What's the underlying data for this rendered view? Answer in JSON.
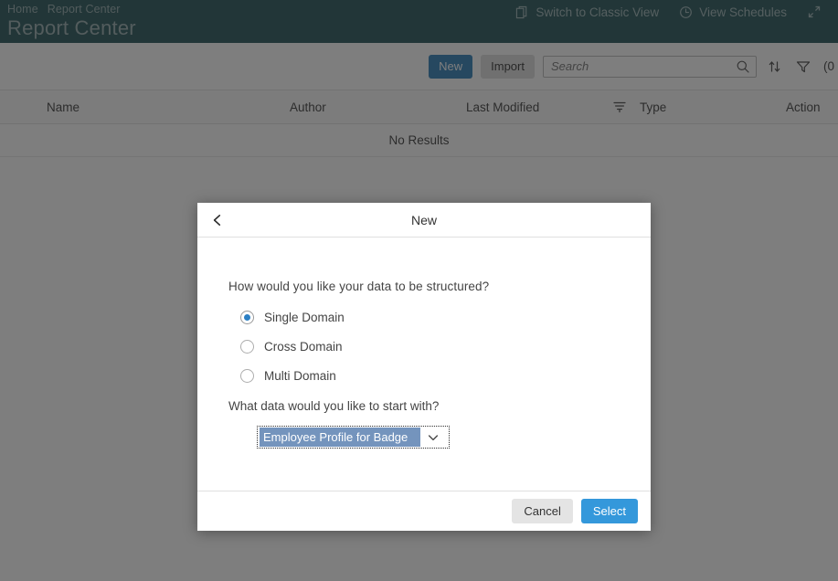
{
  "header": {
    "breadcrumb": [
      "Home",
      "Report Center"
    ],
    "title": "Report Center",
    "actions": [
      {
        "label": "Switch to Classic View",
        "icon": "copy-icon"
      },
      {
        "label": "View Schedules",
        "icon": "clock-icon"
      }
    ],
    "fullscreen_icon": "expand-icon",
    "background_color": "#1b4c50",
    "text_color": "#93abad"
  },
  "toolbar": {
    "new_label": "New",
    "import_label": "Import",
    "search_placeholder": "Search",
    "search_value": "",
    "sort_icon": "sort-arrows-icon",
    "filter_icon": "filter-icon",
    "filter_count": "(0",
    "new_button_color": "#2378b5"
  },
  "table": {
    "columns": [
      "Name",
      "Author",
      "Last Modified",
      "Type",
      "Action"
    ],
    "type_filter_icon": "filter-lines-icon",
    "empty_message": "No Results",
    "rows": []
  },
  "modal": {
    "title": "New",
    "back_icon": "chevron-left-icon",
    "question_1": "How would you like your data to be structured?",
    "options": [
      {
        "label": "Single Domain",
        "selected": true
      },
      {
        "label": "Cross Domain",
        "selected": false
      },
      {
        "label": "Multi Domain",
        "selected": false
      }
    ],
    "question_2": "What data would you like to start with?",
    "dropdown": {
      "value": "Employee Profile for Badge",
      "chevron_icon": "chevron-down-icon",
      "selection_highlight_color": "#7494bd"
    },
    "cancel_label": "Cancel",
    "select_label": "Select",
    "select_button_color": "#3498db"
  }
}
